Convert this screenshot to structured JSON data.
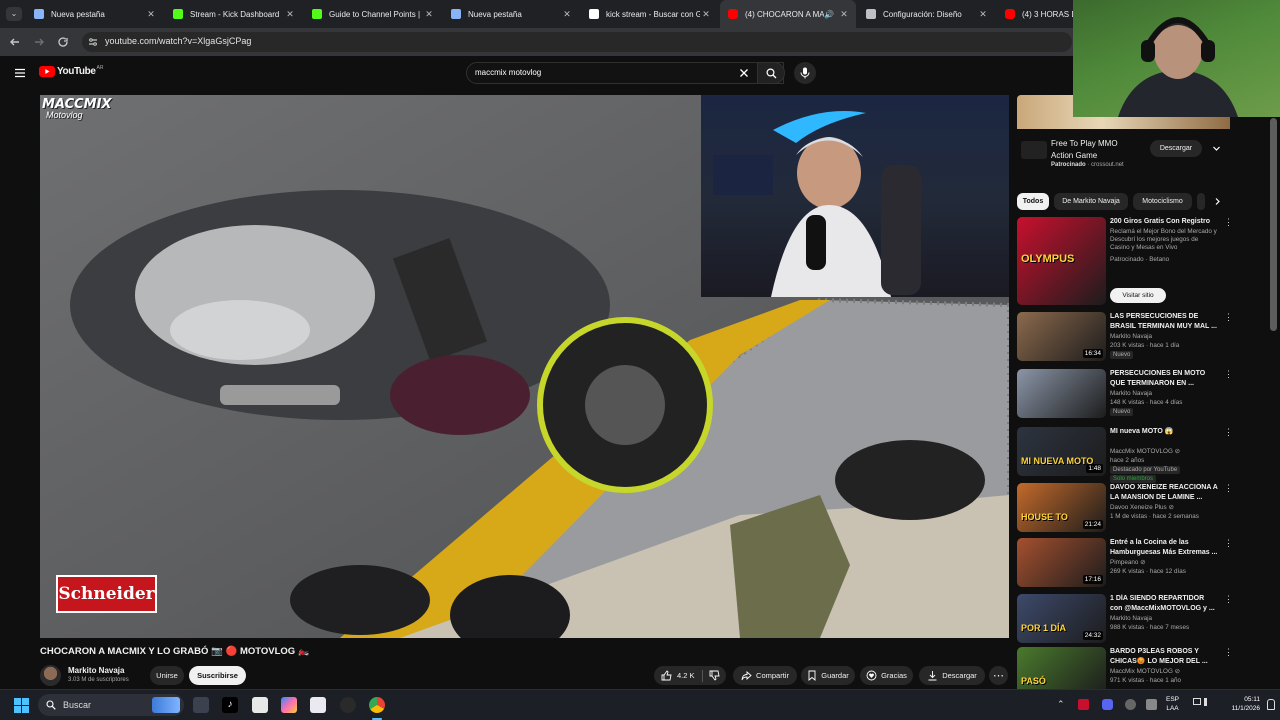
{
  "browser": {
    "tabs": [
      {
        "title": "Nueva pestaña",
        "fav": "#8ab4f8"
      },
      {
        "title": "Stream - Kick Dashboard",
        "fav": "#53fc18"
      },
      {
        "title": "Guide to Channel Points |",
        "fav": "#53fc18"
      },
      {
        "title": "Nueva pestaña",
        "fav": "#8ab4f8"
      },
      {
        "title": "kick stream - Buscar con G",
        "fav": "#ffffff"
      },
      {
        "title": "(4) CHOCARON A MA",
        "fav": "#ff0000"
      },
      {
        "title": "Configuración: Diseño",
        "fav": "#bdc1c6"
      },
      {
        "title": "(4) 3 HORAS DE",
        "fav": "#ff0000"
      }
    ],
    "url": "youtube.com/watch?v=XlgaGsjCPag"
  },
  "youtube": {
    "logo_text": "YouTube",
    "region": "AR",
    "search_query": "maccmix motovlog"
  },
  "video": {
    "title": "CHOCARON A MACMIX Y LO GRABÓ 📷 🔴 MOTOVLOG 🏍️",
    "channel_logo": "MACCMIX",
    "channel_logo_sub": "Motovlog",
    "sponsor_tag": "Schneider"
  },
  "channel": {
    "name": "Markito Navaja",
    "subs": "3.03 M de suscriptores",
    "join": "Unirse",
    "subscribe": "Suscribirse"
  },
  "actions": {
    "likes": "4.2 K",
    "share": "Compartir",
    "save": "Guardar",
    "thanks": "Gracias",
    "download": "Descargar"
  },
  "ad": {
    "title_line1": "Free To Play MMO",
    "title_line2": "Action Game",
    "sponsor": "Patrocinado",
    "domain": "crossout.net",
    "cta": "Descargar"
  },
  "chips": [
    "Todos",
    "De Markito Navaja",
    "Motociclismo"
  ],
  "recs": [
    {
      "title": "200 Giros Gratis Con Registro",
      "line2": "Reclamá el Mejor Bono del Mercado y Descubrí los mejores juegos de Casino y Mesas en Vivo",
      "channel": "Patrocinado · Betano",
      "cta": "Visitar sitio",
      "color": "#c8102e",
      "thumb_text": "OLYMPUS"
    },
    {
      "title": "LAS PERSECUCIONES DE BRASIL TERMINAN MUY MAL ...",
      "channel": "Markito Navaja",
      "meta": "203 K vistas · hace 1 día",
      "badge": "Nuevo",
      "dur": "16:34",
      "color": "#8c6a4d"
    },
    {
      "title": "PERSECUCIONES EN MOTO QUE TERMINARON EN ...",
      "channel": "Markito Navaja",
      "meta": "148 K vistas · hace 4 días",
      "badge": "Nuevo",
      "dur": "",
      "color": "#8b96a8"
    },
    {
      "title": "MI nueva MOTO 😱",
      "channel": "MaccMix MOTOVLOG ⊘",
      "meta": "hace 2 años",
      "badge": "Destacado por YouTube",
      "badge2": "Solo miembros",
      "dur": "1:48",
      "color": "#2d3440",
      "thumb_text": "MI NUEVA MOTO"
    },
    {
      "title": "DAVOO XENEIZE REACCIONA A LA MANSION DE LAMINE ...",
      "channel": "Davoo Xeneize Plus ⊘",
      "meta": "1 M de vistas · hace 2 semanas",
      "dur": "21:24",
      "color": "#c46a2a",
      "thumb_text": "HOUSE TO"
    },
    {
      "title": "Entré a la Cocina de las Hamburguesas Más Extremas ...",
      "channel": "Pimpeano ⊘",
      "meta": "269 K vistas · hace 12 días",
      "dur": "17:16",
      "color": "#a5502f"
    },
    {
      "title": "1 DÍA SIENDO REPARTIDOR con @MaccMixMOTOVLOG y ...",
      "channel": "Markito Navaja",
      "meta": "988 K vistas · hace 7 meses",
      "dur": "24:32",
      "color": "#3d4a6b",
      "thumb_text": "POR 1 DÍA"
    },
    {
      "title": "BARDO P3LEAS ROBOS Y CHICAS😡 LO MEJOR DEL ...",
      "channel": "MaccMix MOTOVLOG ⊘",
      "meta": "971 K vistas · hace 1 año",
      "dur": "",
      "color": "#4a7a2d",
      "thumb_text": "PASÓ"
    }
  ],
  "taskbar": {
    "search": "Buscar",
    "lang1": "ESP",
    "lang2": "LAA",
    "time": "05:11",
    "date": "11/1/2026"
  },
  "colors": {
    "yt_red": "#ff0000",
    "bg": "#0f0f0f",
    "chip_active": "#f1f1f1"
  }
}
